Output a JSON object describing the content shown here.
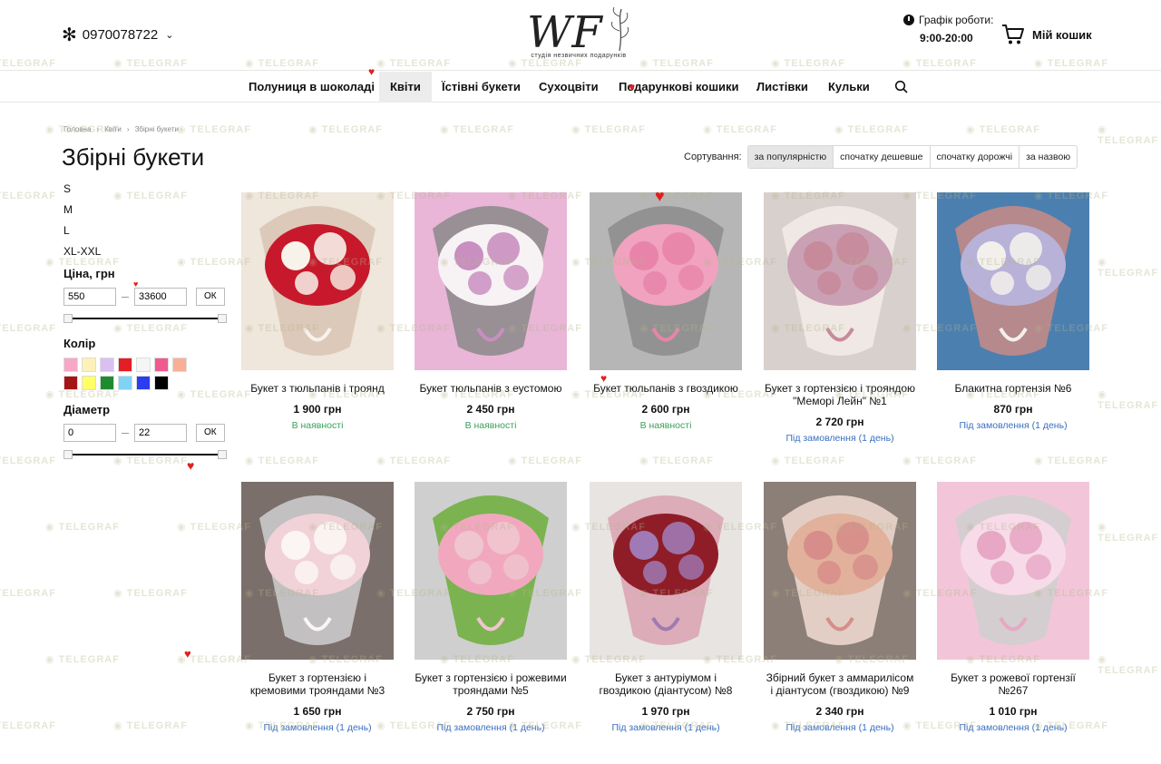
{
  "header": {
    "phone": "0970078722",
    "logo_text": "WF",
    "logo_sub": "студія незвичних подарунків",
    "hours_label": "Графік роботи:",
    "hours_value": "9:00-20:00",
    "cart_label": "Мій кошик"
  },
  "nav": {
    "items": [
      {
        "label": "Полуниця в шоколаді"
      },
      {
        "label": "Квіти"
      },
      {
        "label": "Їстівні букети"
      },
      {
        "label": "Сухоцвіти"
      },
      {
        "label": "Подарункові кошики"
      },
      {
        "label": "Листівки"
      },
      {
        "label": "Кульки"
      }
    ],
    "active": "Квіти"
  },
  "breadcrumb": [
    "Головна",
    "Квіти",
    "Збірні букети"
  ],
  "page_title": "Збірні букети",
  "sort": {
    "label": "Сортування:",
    "options": [
      "за популярністю",
      "спочатку дешевше",
      "спочатку дорожчі",
      "за назвою"
    ],
    "active": "за популярністю"
  },
  "filters": {
    "sizes": [
      "S",
      "M",
      "L",
      "XL-XXL"
    ],
    "price_label": "Ціна, грн",
    "price_min": "550",
    "price_max": "33600",
    "ok_label": "ОК",
    "color_label": "Колір",
    "colors": [
      "#f7a8c6",
      "#fdf1b8",
      "#d9c0f0",
      "#e31e24",
      "#f5f5f5",
      "#ef5b8f",
      "#f7b095",
      "#a51515",
      "#ffff66",
      "#1e8c2e",
      "#7fd3f5",
      "#2c3df0",
      "#000000"
    ],
    "diameter_label": "Діаметр",
    "diameter_min": "0",
    "diameter_max": "22"
  },
  "products": [
    {
      "name": "Букет з тюльпанів і троянд",
      "price": "1 900 грн",
      "stock": "В наявності",
      "status": "avail",
      "palette": [
        "#efe6dc",
        "#c7192b",
        "#f7f2ea",
        "#d8c3b3"
      ]
    },
    {
      "name": "Букет тюльпанів з еустомою",
      "price": "2 450 грн",
      "stock": "В наявності",
      "status": "avail",
      "palette": [
        "#e9b6d7",
        "#f7f2f4",
        "#c98fc0",
        "#8a8a8a"
      ]
    },
    {
      "name": "Букет тюльпанів з гвоздикою",
      "price": "2 600 грн",
      "stock": "В наявності",
      "status": "avail",
      "palette": [
        "#b7b6b6",
        "#f0a2bf",
        "#e884a9",
        "#8c8c8c"
      ]
    },
    {
      "name": "Букет з гортензією і трояндою \"Меморі Лейн\" №1",
      "price": "2 720 грн",
      "stock": "Під замовлення (1 день)",
      "status": "order",
      "palette": [
        "#d8d0cc",
        "#caa0b4",
        "#c78a9a",
        "#f3ece8"
      ]
    },
    {
      "name": "Блакитна гортензія №6",
      "price": "870 грн",
      "stock": "Під замовлення (1 день)",
      "status": "order",
      "palette": [
        "#4b7fb0",
        "#b8b2d8",
        "#f3f0ec",
        "#c98b86"
      ]
    },
    {
      "name": "Букет з гортензією і кремовими трояндами №3",
      "price": "1 650 грн",
      "stock": "Під замовлення (1 день)",
      "status": "order",
      "palette": [
        "#7a6f6a",
        "#f1d2d8",
        "#fbf6f4",
        "#cfcfcf"
      ]
    },
    {
      "name": "Букет з гортензією і рожевими трояндами №5",
      "price": "2 750 грн",
      "stock": "Під замовлення (1 день)",
      "status": "order",
      "palette": [
        "#cfcfcf",
        "#f1a8bf",
        "#efc5d0",
        "#6cae3a"
      ]
    },
    {
      "name": "Букет з антуріумом і гвоздикою (діантусом) №8",
      "price": "1 970 грн",
      "stock": "Під замовлення (1 день)",
      "status": "order",
      "palette": [
        "#e8e4e2",
        "#8e1d28",
        "#a07ab4",
        "#d9a2b0"
      ]
    },
    {
      "name": "Збірний букет з аммарилісом і діантусом (гвоздикою) №9",
      "price": "2 340 грн",
      "stock": "Під замовлення (1 день)",
      "status": "order",
      "palette": [
        "#8c7f78",
        "#e2b19b",
        "#d78d8a",
        "#f1dcd2"
      ]
    },
    {
      "name": "Букет з рожевої гортензії №267",
      "price": "1 010 грн",
      "stock": "Під замовлення (1 день)",
      "status": "order",
      "palette": [
        "#f2c6d8",
        "#f7dbe8",
        "#e7a7c5",
        "#cfcfcf"
      ]
    }
  ],
  "watermark": "TELEGRAF"
}
